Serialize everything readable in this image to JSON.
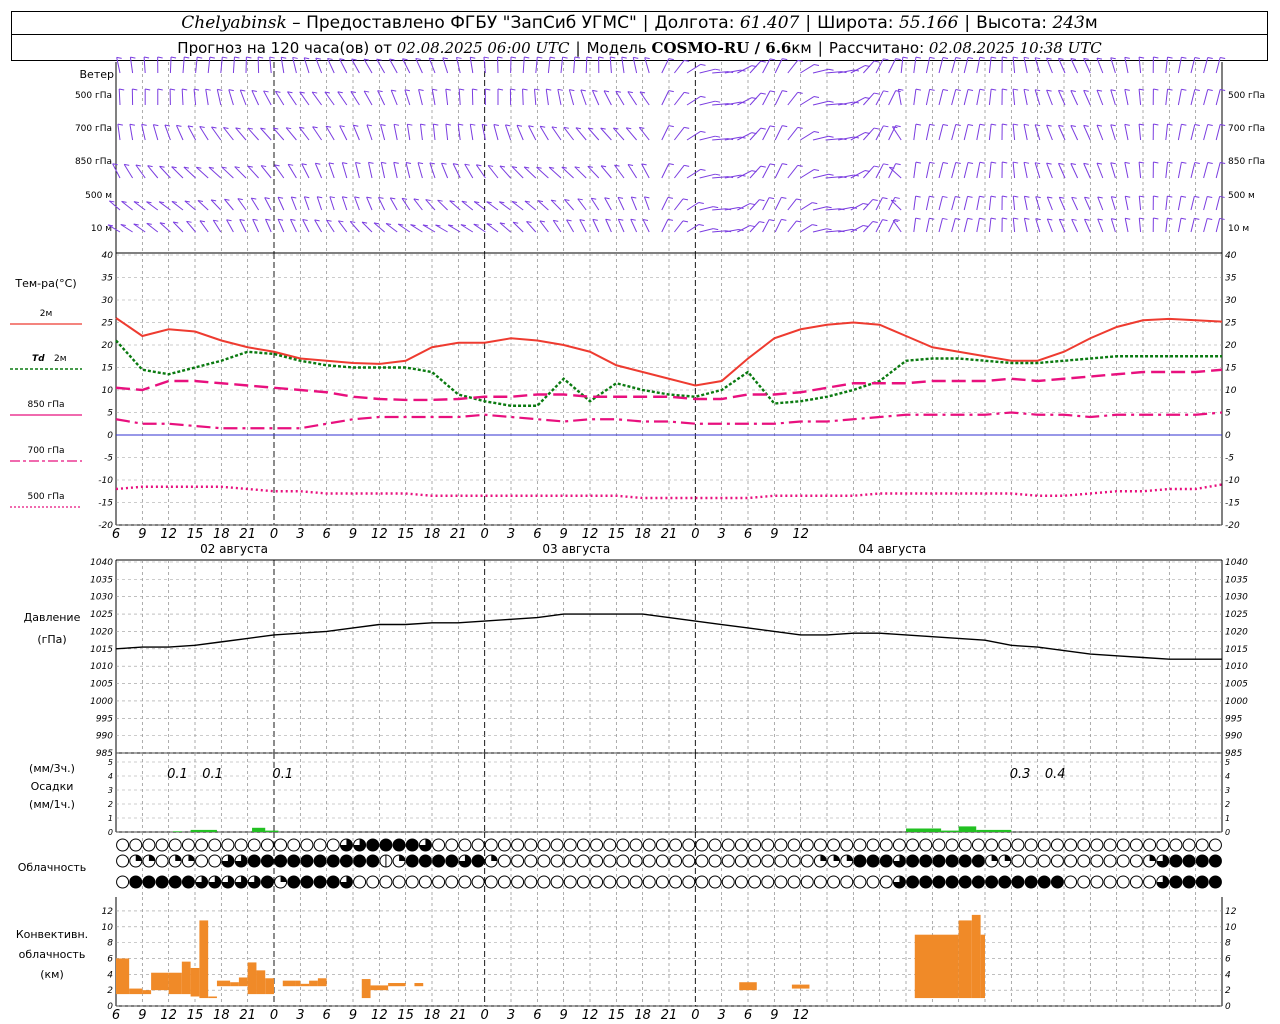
{
  "header": {
    "city": "Chelyabinsk",
    "provider": "– Предоставлено ФГБУ \"ЗапСиб УГМС\"",
    "lon_label": "Долгота:",
    "lon": "61.407",
    "lat_label": "Широта:",
    "lat": "55.166",
    "alt_label": "Высота:",
    "alt": "243",
    "alt_unit": "м",
    "forecast_label": "Прогноз на 120 часа(ов)  от",
    "forecast_start": "02.08.2025 06:00 UTC",
    "model_label": "Модель",
    "model": "COSMO-RU / 6.6",
    "model_unit": "км",
    "calc_label": "Рассчитано:",
    "calc_time": "02.08.2025 10:38 UTC"
  },
  "labels": {
    "wind": "Ветер",
    "wind_levels": [
      "500 гПа",
      "700 гПа",
      "850 гПа",
      "500 м",
      "10  м"
    ],
    "temp": "Тем-ра(°С)",
    "temp_2m": "2м",
    "td": "Td",
    "td_2m": "2м",
    "t850": "850 гПа",
    "t700": "700 гПа",
    "t500": "500 гПа",
    "pressure": "Давление",
    "pressure_unit": "(гПа)",
    "precip_unit3": "(мм/3ч.)",
    "precip": "Осадки",
    "precip_unit1": "(мм/1ч.)",
    "cloud": "Облачность",
    "conv1": "Конвективн.",
    "conv2": "облачность",
    "conv3": "(км)"
  },
  "colors": {
    "wind": "#7a3ce0",
    "t2m": "#ee3b30",
    "td": "#0a7a10",
    "isobaric": "#e8107e",
    "zero": "#3030d0",
    "precip": "#22c022",
    "conv": "#f08a28"
  },
  "chart_data": [
    {
      "type": "line",
      "title": "Тем-ра(°С)",
      "x_hours": [
        0,
        3,
        6,
        9,
        12,
        15,
        18,
        21,
        24,
        27,
        30,
        33,
        36,
        39,
        42,
        45,
        48,
        51,
        54,
        57,
        60,
        63,
        66,
        69,
        72,
        75,
        78,
        81,
        84,
        87,
        90,
        93,
        96,
        99,
        102,
        105,
        108,
        111,
        114,
        117,
        120,
        123,
        126
      ],
      "x_ticks": [
        "6",
        "9",
        "12",
        "15",
        "18",
        "21",
        "0",
        "3",
        "6",
        "9",
        "12",
        "15",
        "18",
        "21",
        "0",
        "3",
        "6",
        "9",
        "12",
        "15",
        "18",
        "21",
        "0",
        "3",
        "6",
        "9",
        "12"
      ],
      "dates": [
        "02 августа",
        "03 августа",
        "04 августа"
      ],
      "ylim": [
        -20,
        40
      ],
      "yticks": [
        -20,
        -15,
        -10,
        -5,
        0,
        5,
        10,
        15,
        20,
        25,
        30,
        35,
        40
      ],
      "series": [
        {
          "name": "2м",
          "values": [
            26,
            22,
            23.5,
            23,
            21,
            19.5,
            18.5,
            17,
            16.5,
            16,
            15.8,
            16.5,
            19.5,
            20.5,
            20.5,
            21.5,
            21,
            20,
            18.5,
            15.5,
            14,
            12.5,
            11,
            12,
            17,
            21.5,
            23.5,
            24.5,
            25,
            24.5,
            22,
            19.5,
            18.5,
            17.5,
            16.5,
            16.5,
            18.5,
            21.5,
            24,
            25.5,
            25.8,
            25.5,
            25.2
          ]
        },
        {
          "name": "Td 2м",
          "values": [
            21,
            14.5,
            13.5,
            15,
            16.5,
            18.5,
            18,
            16.5,
            15.5,
            15,
            15,
            15,
            14,
            9,
            7.5,
            6.5,
            6.5,
            12.5,
            7.5,
            11.5,
            10,
            9,
            8.5,
            10,
            14,
            7,
            7.5,
            8.5,
            10,
            12,
            16.5,
            17,
            17,
            16.5,
            16,
            16,
            16.5,
            17,
            17.5,
            17.5,
            17.5,
            17.5,
            17.5
          ]
        },
        {
          "name": "850 гПа",
          "values": [
            10.5,
            10,
            12,
            12,
            11.5,
            11,
            10.5,
            10,
            9.5,
            8.5,
            8,
            7.8,
            7.8,
            8,
            8.5,
            8.5,
            9,
            9,
            8.5,
            8.5,
            8.5,
            8.5,
            8,
            8,
            9,
            9,
            9.5,
            10.5,
            11.5,
            11.5,
            11.5,
            12,
            12,
            12,
            12.5,
            12,
            12.5,
            13,
            13.5,
            14,
            14,
            14,
            14.5
          ]
        },
        {
          "name": "700 гПа",
          "values": [
            3.5,
            2.5,
            2.5,
            2,
            1.5,
            1.5,
            1.5,
            1.5,
            2.5,
            3.5,
            4,
            4,
            4,
            4,
            4.5,
            4,
            3.5,
            3,
            3.5,
            3.5,
            3,
            3,
            2.5,
            2.5,
            2.5,
            2.5,
            3,
            3,
            3.5,
            4,
            4.5,
            4.5,
            4.5,
            4.5,
            5,
            4.5,
            4.5,
            4,
            4.5,
            4.5,
            4.5,
            4.5,
            5
          ]
        },
        {
          "name": "500 гПа",
          "values": [
            -12,
            -11.5,
            -11.5,
            -11.5,
            -11.5,
            -12,
            -12.5,
            -12.5,
            -13,
            -13,
            -13,
            -13,
            -13.5,
            -13.5,
            -13.5,
            -13.5,
            -13.5,
            -13.5,
            -13.5,
            -13.5,
            -14,
            -14,
            -14,
            -14,
            -14,
            -13.5,
            -13.5,
            -13.5,
            -13.5,
            -13,
            -13,
            -13,
            -13,
            -13,
            -13,
            -13.5,
            -13.5,
            -13,
            -12.5,
            -12.5,
            -12,
            -12,
            -11
          ]
        }
      ]
    },
    {
      "type": "line",
      "title": "Давление",
      "ylim": [
        985,
        1040
      ],
      "yticks": [
        985,
        990,
        995,
        1000,
        1005,
        1010,
        1015,
        1020,
        1025,
        1030,
        1035,
        1040
      ],
      "series": [
        {
          "name": "Давление",
          "values": [
            1015,
            1015.5,
            1015.5,
            1016,
            1017,
            1018,
            1019,
            1019.5,
            1020,
            1021,
            1022,
            1022,
            1022.5,
            1022.5,
            1023,
            1023.5,
            1024,
            1025,
            1025,
            1025,
            1025,
            1024,
            1023,
            1022,
            1021,
            1020,
            1019,
            1019,
            1019.5,
            1019.5,
            1019,
            1018.5,
            1018,
            1017.5,
            1016,
            1015.5,
            1014.5,
            1013.5,
            1013,
            1012.5,
            1012,
            1012,
            1012
          ]
        }
      ]
    },
    {
      "type": "bar",
      "title": "Осадки",
      "ylim": [
        0,
        5
      ],
      "yticks": [
        0,
        1,
        2,
        3,
        4,
        5
      ],
      "annotations": [
        {
          "hour": 7,
          "text": "0.1"
        },
        {
          "hour": 11,
          "text": "0.1"
        },
        {
          "hour": 19,
          "text": "0.1"
        },
        {
          "hour": 103,
          "text": "0.3"
        },
        {
          "hour": 107,
          "text": "0.4"
        }
      ],
      "bars": [
        {
          "h0": 6.5,
          "h1": 7.5,
          "value": 0.05
        },
        {
          "h0": 8.5,
          "h1": 11.5,
          "value": 0.15
        },
        {
          "h0": 15.5,
          "h1": 17,
          "value": 0.3
        },
        {
          "h0": 17,
          "h1": 18.5,
          "value": 0.1
        },
        {
          "h0": 90,
          "h1": 94,
          "value": 0.25
        },
        {
          "h0": 94,
          "h1": 96,
          "value": 0.1
        },
        {
          "h0": 96,
          "h1": 98,
          "value": 0.4
        },
        {
          "h0": 98,
          "h1": 102,
          "value": 0.15
        }
      ]
    },
    {
      "type": "table",
      "title": "Облачность",
      "columns": 84,
      "rows": [
        "000000000000000000000444444000000000000000000000000000000000000000000000000000000000000000000000000000000000000000000000000000000000000000000000000000000000000000000000000000000000000000000000000000000000000000000000000000000000000000000000000000000000000000000000000000000000000000000000000000000000000000000000000000000000000000000000000",
        "",
        ""
      ],
      "row_codes": [
        "000000000000000003344443000000000000000000000000000000000000000000000000000000000000",
        "022022003344444444441244443420000000000000000000000002224443444444220000000000234444",
        "044444333334244443000000000000000000000000000000000000000003444444444444000000034444"
      ],
      "legend_codes": "0=ясно,1=1/8,2=2/8,3=3/8,4=пасмурно"
    },
    {
      "type": "bar",
      "title": "Конвективн. облачность (км)",
      "ylim": [
        0,
        13
      ],
      "yticks": [
        0,
        2,
        4,
        6,
        8,
        10,
        12
      ],
      "bars": [
        {
          "h0": 0,
          "h1": 1.5,
          "bottom": 1.5,
          "top": 6
        },
        {
          "h0": 1.5,
          "h1": 3,
          "bottom": 1.5,
          "top": 2.2
        },
        {
          "h0": 3,
          "h1": 4,
          "bottom": 1.5,
          "top": 2
        },
        {
          "h0": 4,
          "h1": 6,
          "bottom": 2,
          "top": 4.2
        },
        {
          "h0": 6,
          "h1": 7.5,
          "bottom": 1.5,
          "top": 4.2
        },
        {
          "h0": 7.5,
          "h1": 8.5,
          "bottom": 1.5,
          "top": 5.6
        },
        {
          "h0": 8.5,
          "h1": 9.5,
          "bottom": 1.2,
          "top": 4.8
        },
        {
          "h0": 9.5,
          "h1": 10.5,
          "bottom": 1,
          "top": 10.8
        },
        {
          "h0": 10.5,
          "h1": 11.5,
          "bottom": 1,
          "top": 1.2
        },
        {
          "h0": 11.5,
          "h1": 13,
          "bottom": 2.5,
          "top": 3.2
        },
        {
          "h0": 13,
          "h1": 14,
          "bottom": 2.5,
          "top": 3
        },
        {
          "h0": 14,
          "h1": 15,
          "bottom": 2.5,
          "top": 3.6
        },
        {
          "h0": 15,
          "h1": 16,
          "bottom": 1.5,
          "top": 5.5
        },
        {
          "h0": 16,
          "h1": 17,
          "bottom": 1.5,
          "top": 4.5
        },
        {
          "h0": 17,
          "h1": 18,
          "bottom": 1.5,
          "top": 3.5
        },
        {
          "h0": 19,
          "h1": 20.5,
          "bottom": 2.5,
          "top": 3.2
        },
        {
          "h0": 20.5,
          "h1": 21,
          "bottom": 2.5,
          "top": 3.2
        },
        {
          "h0": 21,
          "h1": 22,
          "bottom": 2.5,
          "top": 2.8
        },
        {
          "h0": 22,
          "h1": 23,
          "bottom": 2.5,
          "top": 3.2
        },
        {
          "h0": 23,
          "h1": 24,
          "bottom": 2.5,
          "top": 3.5
        },
        {
          "h0": 28,
          "h1": 29,
          "bottom": 1,
          "top": 3.4
        },
        {
          "h0": 29,
          "h1": 31,
          "bottom": 2,
          "top": 2.6
        },
        {
          "h0": 31,
          "h1": 33,
          "bottom": 2.5,
          "top": 2.9
        },
        {
          "h0": 34,
          "h1": 35,
          "bottom": 2.5,
          "top": 2.9
        },
        {
          "h0": 71,
          "h1": 73,
          "bottom": 2,
          "top": 3
        },
        {
          "h0": 77,
          "h1": 79,
          "bottom": 2.2,
          "top": 2.7
        },
        {
          "h0": 91,
          "h1": 96,
          "bottom": 1,
          "top": 9
        },
        {
          "h0": 96,
          "h1": 97.5,
          "bottom": 1,
          "top": 10.8
        },
        {
          "h0": 97.5,
          "h1": 98.5,
          "bottom": 1,
          "top": 11.5
        },
        {
          "h0": 98.5,
          "h1": 99,
          "bottom": 1,
          "top": 9
        }
      ]
    }
  ]
}
